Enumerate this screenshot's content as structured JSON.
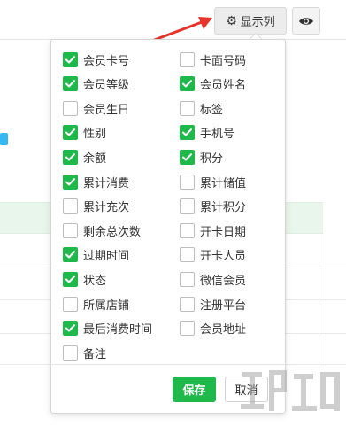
{
  "toolbar": {
    "columns_label": "显示列",
    "columns_icon": "gear-icon",
    "eye_icon": "eye-icon"
  },
  "column_options": [
    {
      "label": "会员卡号",
      "checked": true
    },
    {
      "label": "卡面号码",
      "checked": false
    },
    {
      "label": "会员等级",
      "checked": true
    },
    {
      "label": "会员姓名",
      "checked": true
    },
    {
      "label": "会员生日",
      "checked": false
    },
    {
      "label": "标签",
      "checked": false
    },
    {
      "label": "性别",
      "checked": true
    },
    {
      "label": "手机号",
      "checked": true
    },
    {
      "label": "余额",
      "checked": true
    },
    {
      "label": "积分",
      "checked": true
    },
    {
      "label": "累计消费",
      "checked": true
    },
    {
      "label": "累计储值",
      "checked": false
    },
    {
      "label": "累计充次",
      "checked": false
    },
    {
      "label": "累计积分",
      "checked": false
    },
    {
      "label": "剩余总次数",
      "checked": false
    },
    {
      "label": "开卡日期",
      "checked": false
    },
    {
      "label": "过期时间",
      "checked": true
    },
    {
      "label": "开卡人员",
      "checked": false
    },
    {
      "label": "状态",
      "checked": true
    },
    {
      "label": "微信会员",
      "checked": false
    },
    {
      "label": "所属店铺",
      "checked": false
    },
    {
      "label": "注册平台",
      "checked": false
    },
    {
      "label": "最后消费时间",
      "checked": true
    },
    {
      "label": "会员地址",
      "checked": false
    },
    {
      "label": "备注",
      "checked": false
    }
  ],
  "footer": {
    "save_label": "保存",
    "cancel_label": "取消"
  },
  "colors": {
    "checked": "#1fb84b",
    "accent_arrow": "#e8322b"
  }
}
